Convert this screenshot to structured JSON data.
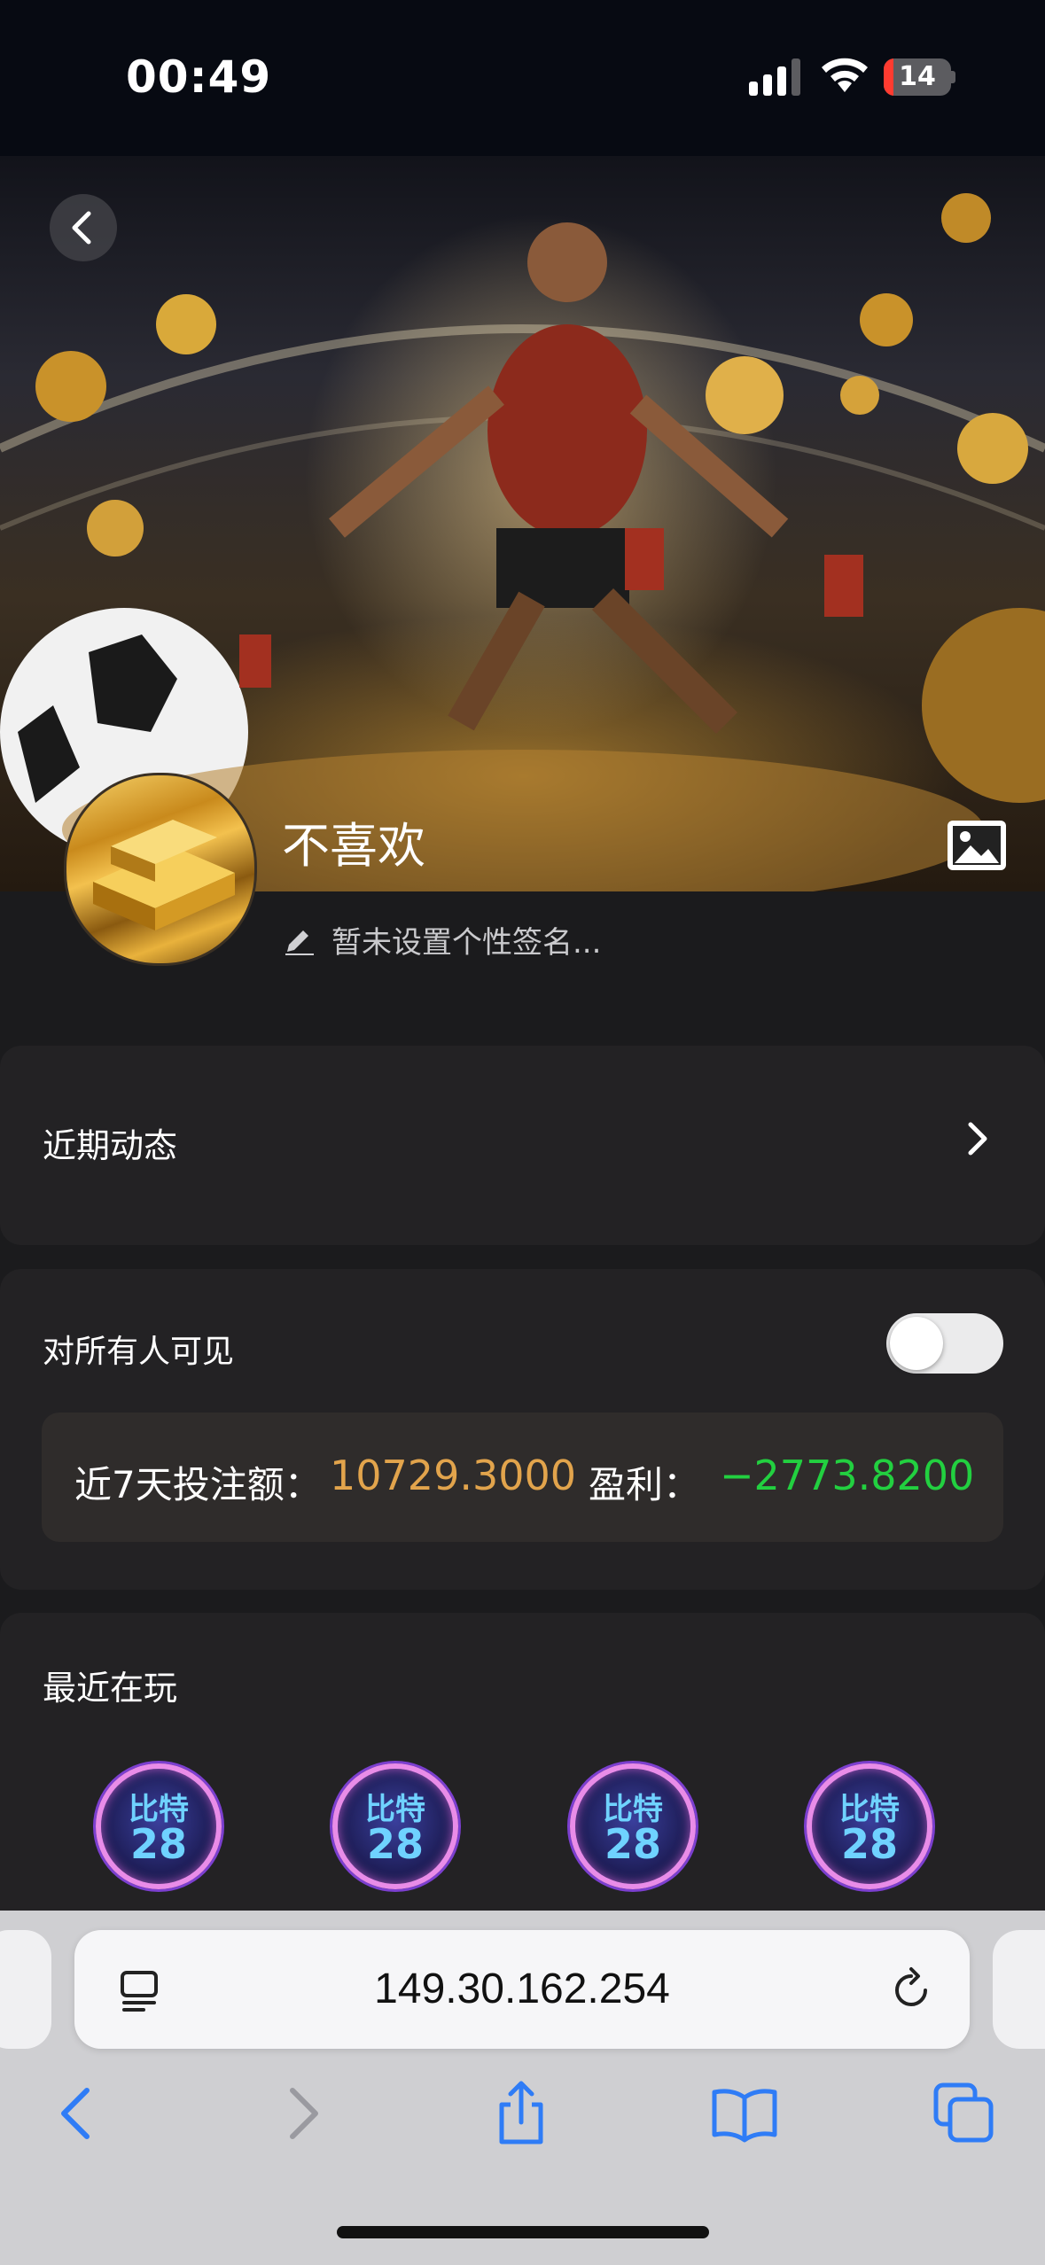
{
  "status_bar": {
    "time": "00:49",
    "battery_level": "14"
  },
  "profile": {
    "username": "不喜欢",
    "signature": "暂未设置个性签名..."
  },
  "recent_activity": {
    "title": "近期动态"
  },
  "visibility": {
    "label": "对所有人可见",
    "toggle_on": false
  },
  "stats": {
    "bet_label": "近7天投注额：",
    "bet_amount": "10729.3000",
    "profit_label": "盈利：",
    "profit_amount": "−2773.8200"
  },
  "recently_playing": {
    "title": "最近在玩",
    "games": [
      {
        "name_line1": "比特",
        "name_line2": "28"
      },
      {
        "name_line1": "比特",
        "name_line2": "28"
      },
      {
        "name_line1": "比特",
        "name_line2": "28"
      },
      {
        "name_line1": "比特",
        "name_line2": "28"
      }
    ]
  },
  "browser": {
    "url": "149.30.162.254"
  },
  "colors": {
    "amount_orange": "#e2a44c",
    "profit_green": "#22d040",
    "ios_blue": "#2f7cf6"
  }
}
